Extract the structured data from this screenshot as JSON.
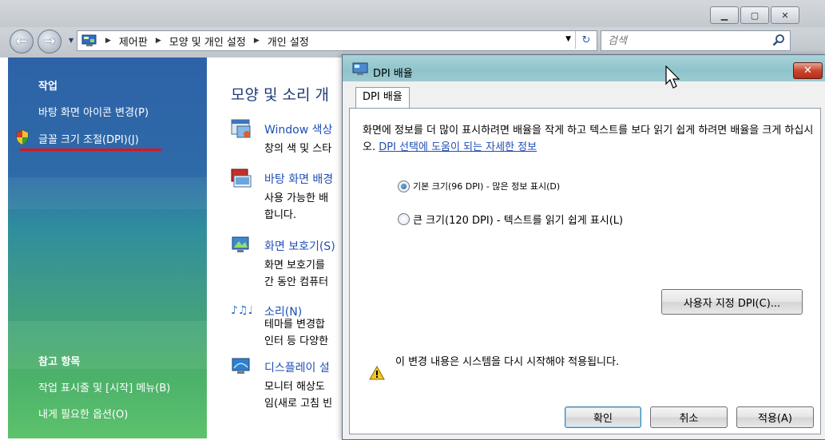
{
  "explorer": {
    "breadcrumb": [
      "제어판",
      "모양 및 개인 설정",
      "개인 설정"
    ],
    "search_placeholder": "검색",
    "sidebar": {
      "tasks_heading": "작업",
      "task_links": [
        "바탕 화면 아이콘 변경(P)",
        "글꼴 크기 조절(DPI)(J)"
      ],
      "see_also_heading": "참고 항목",
      "see_also_links": [
        "작업 표시줄 및 [시작] 메뉴(B)",
        "내게 필요한 옵션(O)"
      ]
    },
    "content": {
      "title": "모양 및 소리 개",
      "tasks": [
        {
          "icon": "window-color-icon",
          "link": "Window 색상",
          "desc": "창의 색 및 스타"
        },
        {
          "icon": "desktop-background-icon",
          "link": "바탕 화면 배경",
          "desc": "사용 가능한 배\n합니다."
        },
        {
          "icon": "screensaver-icon",
          "link": "화면 보호기(S)",
          "desc": "화면 보호기를\n간 동안 컴퓨터"
        },
        {
          "icon": "sounds-icon",
          "link": "소리(N)",
          "desc": "테마를 변경합\n인터 등 다양한"
        },
        {
          "icon": "display-settings-icon",
          "link": "디스플레이 설",
          "desc": "모니터 해상도\n임(새로 고침 빈"
        }
      ]
    }
  },
  "dialog": {
    "title": "DPI 배율",
    "tab_label": "DPI 배율",
    "description": "화면에 정보를 더 많이 표시하려면 배율을 작게 하고 텍스트를 보다 읽기 쉽게 하려면 배율을 크게 하십시오.",
    "help_link": "DPI 선택에 도움이 되는 자세한 정보",
    "options": [
      {
        "label": "기본 크기(96 DPI) - 많은 정보 표시(D)",
        "checked": true
      },
      {
        "label": "큰 크기(120 DPI) - 텍스트를 읽기 쉽게 표시(L)",
        "checked": false
      }
    ],
    "custom_dpi_button": "사용자 지정 DPI(C)...",
    "restart_notice": "이 변경 내용은 시스템을 다시 시작해야 적용됩니다.",
    "ok_button": "확인",
    "cancel_button": "취소",
    "apply_button": "적용(A)"
  },
  "colors": {
    "sidebar_top": "#2e62a8",
    "sidebar_bottom": "#5cc26c",
    "link_blue": "#1f4fb5",
    "dialog_titlebar": "#9ccbd0",
    "highlight_underline": "#e0141b"
  }
}
